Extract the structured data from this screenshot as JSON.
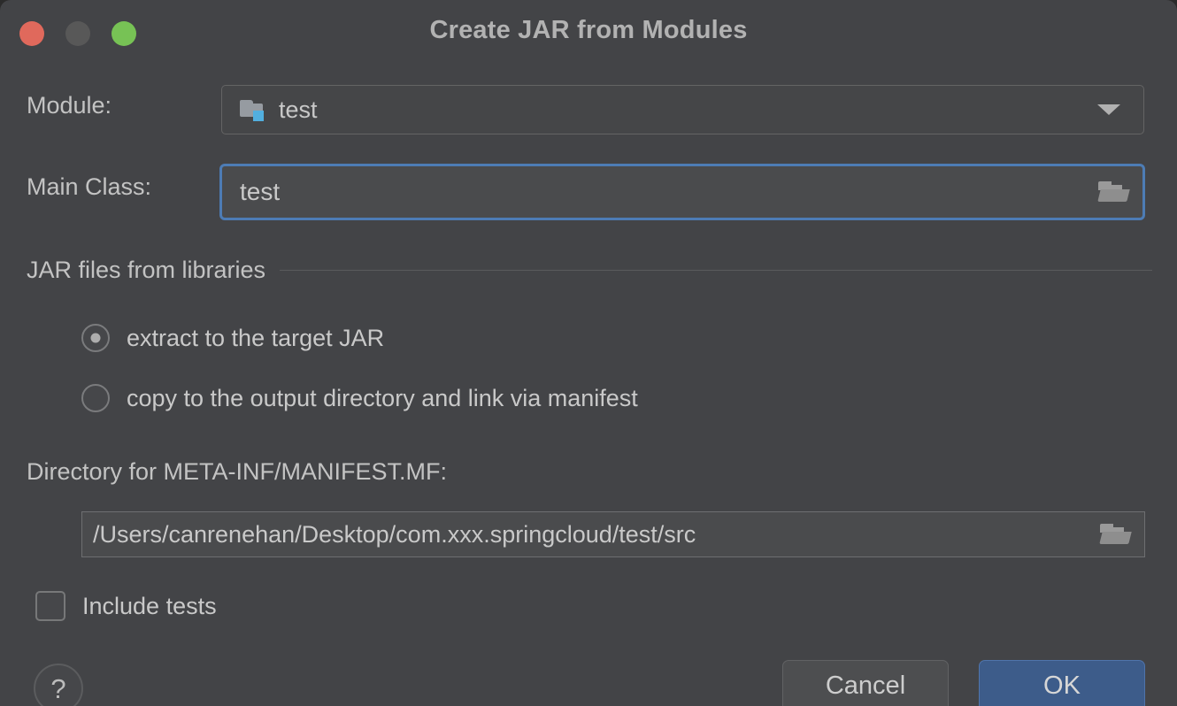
{
  "window": {
    "title": "Create JAR from Modules",
    "controls": {
      "close": "close-button",
      "minimize": "minimize-button",
      "maximize": "maximize-button"
    },
    "colors": {
      "background": "#434447",
      "close": "#e0695c",
      "minimize": "#585858",
      "maximize": "#77c255",
      "focus_ring": "#4d7cb5",
      "primary_button": "#3d5c8a",
      "module_icon_accent": "#52afdf",
      "text": "#c9c9c9"
    }
  },
  "form": {
    "module": {
      "label": "Module:",
      "value": "test",
      "icon": "module-folder-icon",
      "dropdown_icon": "chevron-down-icon"
    },
    "main_class": {
      "label": "Main Class:",
      "value": "test",
      "browse_icon": "open-folder-icon",
      "focused": true
    },
    "libraries_section": {
      "title": "JAR files from libraries",
      "options": [
        {
          "label": "extract to the target JAR",
          "selected": true
        },
        {
          "label": "copy to the output directory and link via manifest",
          "selected": false
        }
      ]
    },
    "manifest_directory": {
      "label": "Directory for META-INF/MANIFEST.MF:",
      "value": "/Users/canrenehan/Desktop/com.xxx.springcloud/test/src",
      "browse_icon": "open-folder-icon"
    },
    "include_tests": {
      "label": "Include tests",
      "checked": false
    }
  },
  "footer": {
    "help_label": "?",
    "cancel_label": "Cancel",
    "ok_label": "OK"
  }
}
